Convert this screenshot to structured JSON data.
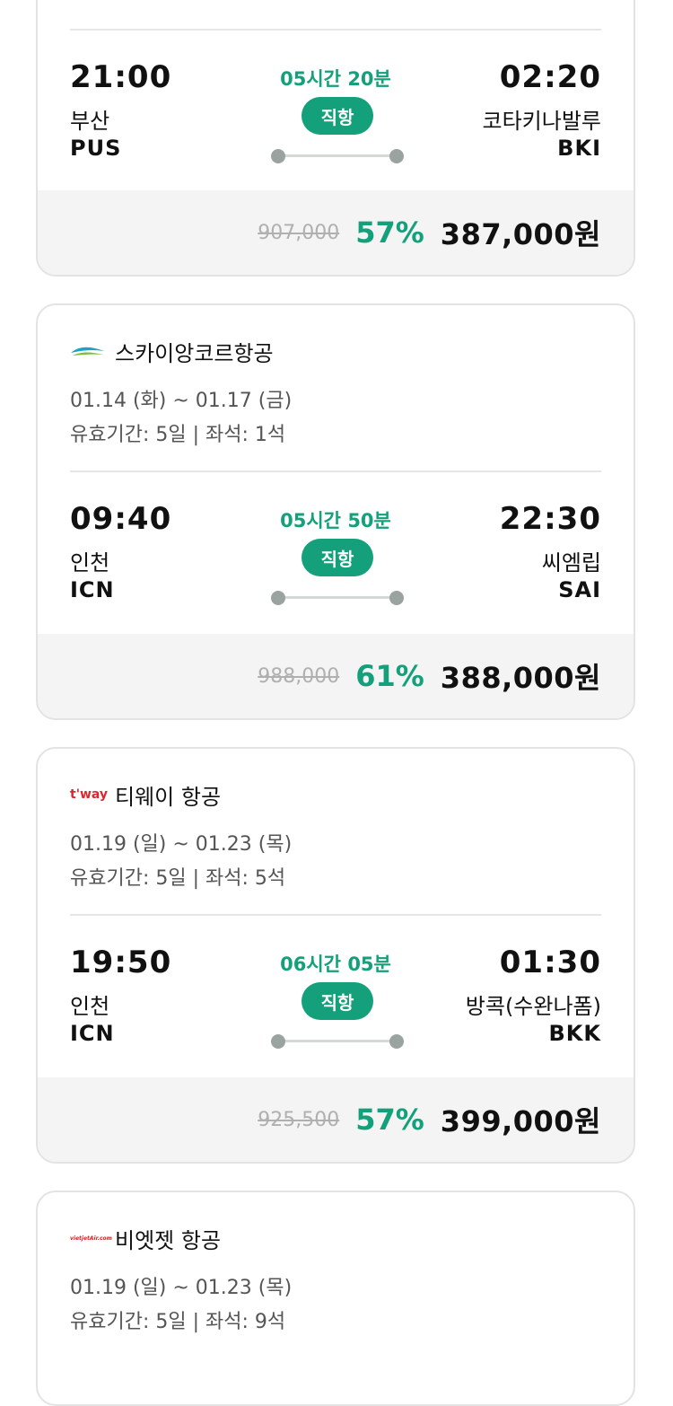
{
  "flights": [
    {
      "dep_time": "21:00",
      "dep_city": "부산",
      "dep_code": "PUS",
      "duration": "05시간 20분",
      "direct": "직항",
      "arr_time": "02:20",
      "arr_city": "코타키나발루",
      "arr_code": "BKI",
      "original_price": "907,000",
      "discount": "57%",
      "price": "387,000원"
    },
    {
      "airline": "스카이앙코르항공",
      "logo": "sky-angkor-logo",
      "dates": "01.14 (화) ~ 01.17 (금)",
      "validity": "유효기간: 5일 | 좌석: 1석",
      "dep_time": "09:40",
      "dep_city": "인천",
      "dep_code": "ICN",
      "duration": "05시간 50분",
      "direct": "직항",
      "arr_time": "22:30",
      "arr_city": "씨엠립",
      "arr_code": "SAI",
      "original_price": "988,000",
      "discount": "61%",
      "price": "388,000원"
    },
    {
      "airline": "티웨이 항공",
      "logo_text": "t'way",
      "dates": "01.19 (일) ~ 01.23 (목)",
      "validity": "유효기간: 5일 | 좌석: 5석",
      "dep_time": "19:50",
      "dep_city": "인천",
      "dep_code": "ICN",
      "duration": "06시간 05분",
      "direct": "직항",
      "arr_time": "01:30",
      "arr_city": "방콕(수완나폼)",
      "arr_code": "BKK",
      "original_price": "925,500",
      "discount": "57%",
      "price": "399,000원"
    },
    {
      "airline": "비엣젯 항공",
      "logo_text": "vietjetAir.com",
      "dates": "01.19 (일) ~ 01.23 (목)",
      "validity": "유효기간: 5일 | 좌석: 9석"
    }
  ],
  "colors": {
    "accent": "#13a07a",
    "tway": "#d8282f",
    "vietjet": "#e01b22"
  }
}
